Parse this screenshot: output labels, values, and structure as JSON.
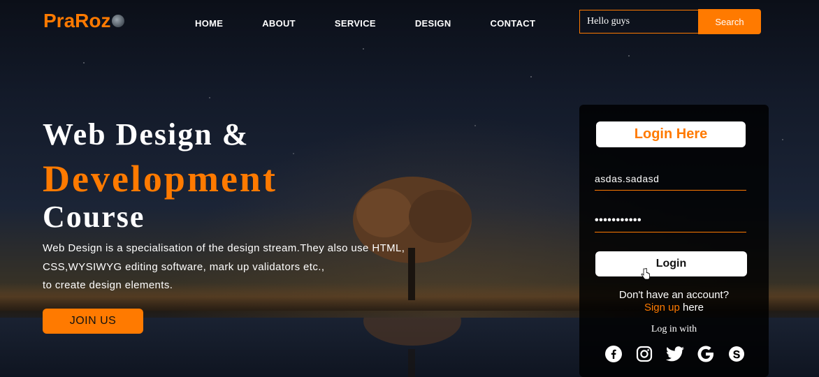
{
  "brand": {
    "name": "PraRoz",
    "accent": "#ff7a00"
  },
  "nav": {
    "items": [
      {
        "label": "HOME"
      },
      {
        "label": "ABOUT"
      },
      {
        "label": "SERVICE"
      },
      {
        "label": "DESIGN"
      },
      {
        "label": "CONTACT"
      }
    ]
  },
  "search": {
    "value": "Hello guys",
    "button_label": "Search"
  },
  "hero": {
    "line1": "Web Design &",
    "line2": "Development",
    "line3": "Course",
    "description": [
      "Web Design is a specialisation of the design stream.They also use HTML,",
      "CSS,WYSIWYG editing software, mark up validators etc.,",
      "to create design elements."
    ],
    "cta_label": "JOIN US"
  },
  "login": {
    "title": "Login Here",
    "username_value": "asdas.sadasd",
    "password_value": "•••••••••••",
    "button_label": "Login",
    "no_account_text": "Don't have an account?",
    "signup_link": "Sign up",
    "signup_suffix": " here",
    "log_in_with": "Log in with",
    "social_icons": [
      "facebook-icon",
      "instagram-icon",
      "twitter-icon",
      "google-icon",
      "skype-icon"
    ]
  }
}
